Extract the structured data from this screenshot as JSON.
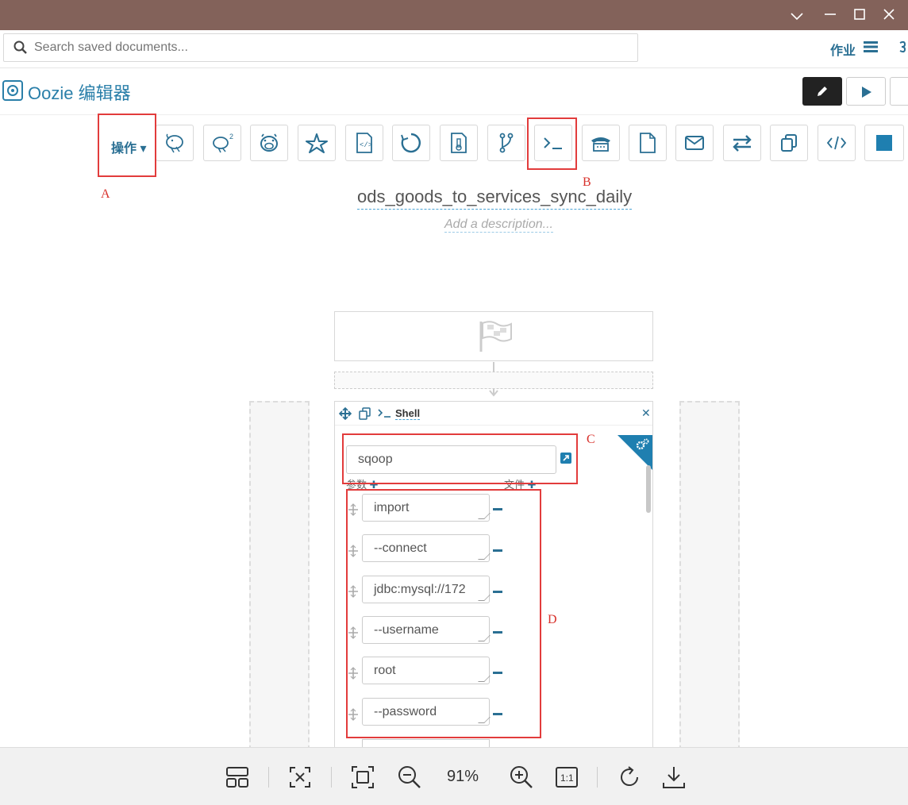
{
  "window": {
    "controls": [
      "chevron-down",
      "minimize",
      "maximize",
      "close"
    ]
  },
  "search": {
    "placeholder": "Search saved documents..."
  },
  "header": {
    "jobs_label": "作业"
  },
  "editor": {
    "title": "Oozie 编辑器"
  },
  "toolbar": {
    "actions_label": "操作",
    "tools": [
      "hive-icon",
      "hive2-icon",
      "pig-icon",
      "spark-icon",
      "java-icon",
      "subworkflow-icon",
      "distcp-icon",
      "fork-icon",
      "shell-icon",
      "ssh-icon",
      "fs-icon",
      "email-icon",
      "streaming-icon",
      "copy-icon",
      "generic-icon",
      "kill-icon"
    ]
  },
  "workflow": {
    "name": "ods_goods_to_services_sync_daily",
    "description_placeholder": "Add a description..."
  },
  "node": {
    "type": "Shell",
    "command": "sqoop",
    "params_label": "参数",
    "files_label": "文件",
    "arguments": [
      "import",
      "--connect",
      "jdbc:mysql://172",
      "--username",
      "root",
      "--password"
    ]
  },
  "annotations": {
    "a": "A",
    "b": "B",
    "c": "C",
    "d": "D"
  },
  "viewer": {
    "zoom": "91%"
  },
  "colors": {
    "titlebar": "#83625a",
    "accent": "#2a6f93",
    "annotation": "#e23c3c"
  }
}
